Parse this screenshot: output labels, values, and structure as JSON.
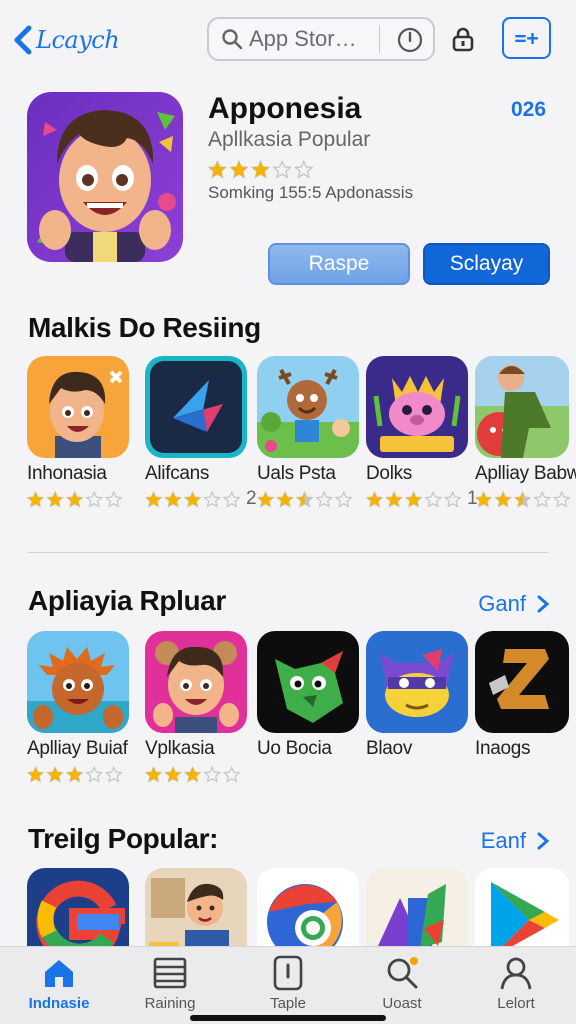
{
  "header": {
    "back_label": "Lcaych",
    "search_placeholder": "App Stor…",
    "icons": [
      "chevron-left-icon",
      "search-icon",
      "mic-icon",
      "lock-icon",
      "add-icon"
    ],
    "add_label": "=+"
  },
  "featured": {
    "title": "Apponesia",
    "subtitle": "Apllkasia Popular",
    "count": "026",
    "rating": 3,
    "meta": "Somking 155:5 Apdonassis",
    "button_secondary": "Raspe",
    "button_primary": "Sclayay"
  },
  "sections": [
    {
      "title": "Malkis Do Resiing",
      "apps": [
        {
          "name": "Inhonasia",
          "rating": 3,
          "count": ""
        },
        {
          "name": "Alifcans",
          "rating": 3,
          "count": "2"
        },
        {
          "name": "Uals Psta",
          "rating": 2.5,
          "count": ""
        },
        {
          "name": "Dolks",
          "rating": 3,
          "count": "1"
        },
        {
          "name": "Aplliay Babwo",
          "rating": 2.5,
          "count": ""
        }
      ]
    },
    {
      "title": "Apliayia Rpluar",
      "see_all": "Ganf",
      "apps": [
        {
          "name": "Aplliay Buiaf",
          "rating": 3,
          "count": ""
        },
        {
          "name": "Vplkasia",
          "rating": 3,
          "count": ""
        },
        {
          "name": "Uo Bocia",
          "rating": null,
          "count": ""
        },
        {
          "name": "Blaov",
          "rating": null,
          "count": ""
        },
        {
          "name": "Inaogs",
          "rating": null,
          "count": ""
        }
      ]
    },
    {
      "title": "Treilg Popular:",
      "see_all": "Eanf",
      "apps": [
        {
          "name": "",
          "icon": "g-logo-icon"
        },
        {
          "name": "",
          "icon": "person-app-icon"
        },
        {
          "name": "",
          "icon": "browser-icon"
        },
        {
          "name": "",
          "icon": "shapes-icon"
        },
        {
          "name": "",
          "icon": "play-store-icon"
        }
      ]
    }
  ],
  "tabbar": {
    "tabs": [
      {
        "label": "Indnasie",
        "icon": "home-icon",
        "active": true
      },
      {
        "label": "Raining",
        "icon": "list-icon",
        "active": false
      },
      {
        "label": "Taple",
        "icon": "tablet-icon",
        "active": false
      },
      {
        "label": "Uoast",
        "icon": "search-icon",
        "active": false
      },
      {
        "label": "Lelort",
        "icon": "person-icon",
        "active": false
      }
    ]
  },
  "colors": {
    "accent": "#1a73e8",
    "star": "#f4b400",
    "star_empty": "#c4c4c8"
  }
}
